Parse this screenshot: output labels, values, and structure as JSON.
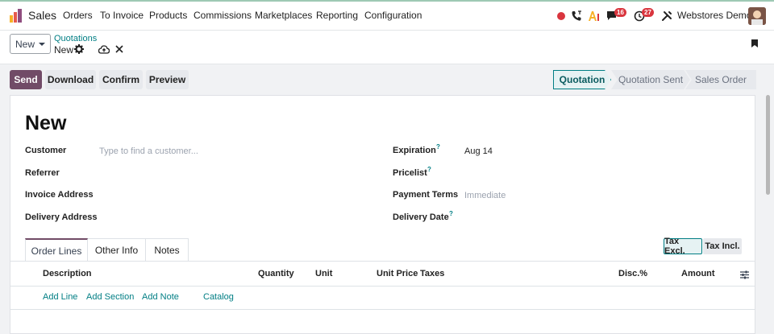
{
  "app": {
    "name": "Sales"
  },
  "nav": {
    "menus": [
      "Orders",
      "To Invoice",
      "Products",
      "Commissions",
      "Marketplaces",
      "Reporting",
      "Configuration"
    ],
    "messages_badge": "16",
    "activities_badge": "27",
    "company": "Webstores Demo"
  },
  "control": {
    "new_label": "New",
    "breadcrumb_parent": "Quotations",
    "breadcrumb_current": "New"
  },
  "actions": {
    "send": "Send",
    "download": "Download",
    "confirm": "Confirm",
    "preview": "Preview"
  },
  "stages": {
    "items": [
      "Quotation",
      "Quotation Sent",
      "Sales Order"
    ],
    "active": "Quotation"
  },
  "form": {
    "title": "New",
    "customer_label": "Customer",
    "customer_placeholder": "Type to find a customer...",
    "referrer_label": "Referrer",
    "invoice_address_label": "Invoice Address",
    "delivery_address_label": "Delivery Address",
    "expiration_label": "Expiration",
    "expiration_value": "Aug 14",
    "pricelist_label": "Pricelist",
    "payment_terms_label": "Payment Terms",
    "payment_terms_placeholder": "Immediate",
    "delivery_date_label": "Delivery Date",
    "help_mark": "?"
  },
  "tabs": {
    "order_lines": "Order Lines",
    "other_info": "Other Info",
    "notes": "Notes"
  },
  "tax": {
    "excl": "Tax Excl.",
    "incl": "Tax Incl."
  },
  "table": {
    "headers": {
      "description": "Description",
      "quantity": "Quantity",
      "unit": "Unit",
      "unit_price": "Unit Price",
      "taxes": "Taxes",
      "disc": "Disc.%",
      "amount": "Amount"
    },
    "add_line": "Add Line",
    "add_section": "Add Section",
    "add_note": "Add Note",
    "catalog": "Catalog"
  },
  "colors": {
    "primary": "#714b67",
    "accent": "#017e84",
    "badge": "#d9353e"
  }
}
